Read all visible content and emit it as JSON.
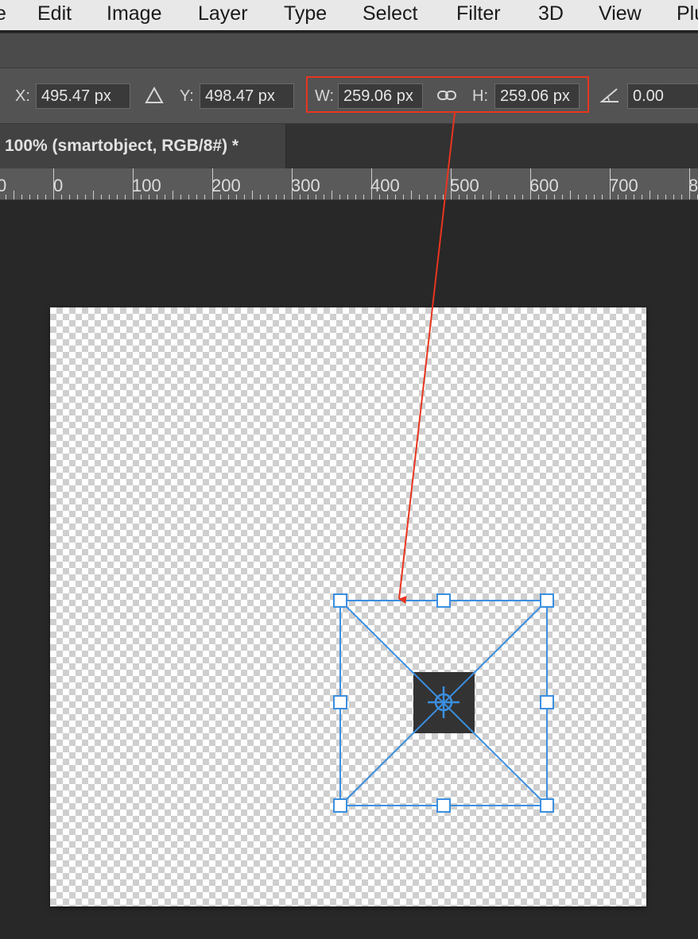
{
  "menu": {
    "items": [
      "e",
      "Edit",
      "Image",
      "Layer",
      "Type",
      "Select",
      "Filter",
      "3D",
      "View",
      "Plu"
    ]
  },
  "options_bar": {
    "x_label": "X:",
    "x_value": "495.47 px",
    "y_label": "Y:",
    "y_value": "498.47 px",
    "w_label": "W:",
    "w_value": "259.06 px",
    "h_label": "H:",
    "h_value": "259.06 px",
    "angle_value": "0.00"
  },
  "document_tab": {
    "title": "100% (smartobject, RGB/8#) *"
  },
  "ruler": {
    "ticks": [
      "0",
      "0",
      "100",
      "200",
      "300",
      "400",
      "500",
      "600",
      "700",
      "8"
    ]
  },
  "colors": {
    "highlight": "#e8351f",
    "transform_box": "#3b8fe0",
    "canvas_bg": "#282828"
  },
  "icons": [
    "reference-point-icon",
    "link-icon",
    "angle-icon",
    "center-crosshair-icon"
  ]
}
